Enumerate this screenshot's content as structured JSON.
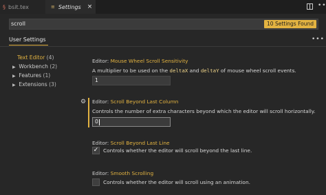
{
  "tabs": {
    "file_tab": {
      "label": "bsit.tex",
      "icon": "tex-file-icon"
    },
    "settings_tab": {
      "label": "Settings",
      "icon": "settings-file-icon",
      "close": "×"
    }
  },
  "toolbar": {
    "split_icon": "split-editor-icon",
    "more": "•••"
  },
  "search": {
    "value": "scroll",
    "results_badge": "10 Settings Found"
  },
  "scope": {
    "label": "User Settings",
    "more": "•••"
  },
  "tree": [
    {
      "label": "Text Editor",
      "count": "(4)",
      "expanded": true,
      "active": true
    },
    {
      "label": "Workbench",
      "count": "(2)",
      "expanded": false,
      "active": false
    },
    {
      "label": "Features",
      "count": "(1)",
      "expanded": false,
      "active": false
    },
    {
      "label": "Extensions",
      "count": "(3)",
      "expanded": false,
      "active": false
    }
  ],
  "settings": {
    "wheel": {
      "prefix": "Editor: ",
      "name": "Mouse Wheel Scroll Sensitivity",
      "desc_a": "A multiplier to be used on the ",
      "code1": "deltaX",
      "desc_b": " and ",
      "code2": "deltaY",
      "desc_c": " of mouse wheel scroll events.",
      "value": "1"
    },
    "beyond_column": {
      "prefix": "Editor: ",
      "name": "Scroll Beyond Last Column",
      "desc": "Controls the number of extra characters beyond which the editor will scroll horizontally.",
      "value": "0"
    },
    "beyond_line": {
      "prefix": "Editor: ",
      "name": "Scroll Beyond Last Line",
      "desc": "Controls whether the editor will scroll beyond the last line.",
      "checked": true
    },
    "smooth": {
      "prefix": "Editor: ",
      "name": "Smooth Scrolling",
      "desc": "Controls whether the editor will scroll using an animation.",
      "checked": false
    }
  },
  "colors": {
    "accent": "#e3b341",
    "background": "#272727"
  }
}
